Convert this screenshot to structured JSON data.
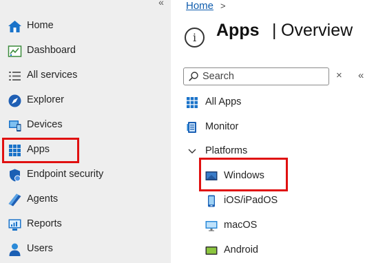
{
  "sidebar": {
    "collapse_glyph": "«",
    "items": [
      {
        "label": "Home",
        "icon": "home-icon"
      },
      {
        "label": "Dashboard",
        "icon": "dashboard-icon"
      },
      {
        "label": "All services",
        "icon": "list-icon"
      },
      {
        "label": "Explorer",
        "icon": "explorer-icon"
      },
      {
        "label": "Devices",
        "icon": "devices-icon"
      },
      {
        "label": "Apps",
        "icon": "apps-grid-icon"
      },
      {
        "label": "Endpoint security",
        "icon": "shield-icon"
      },
      {
        "label": "Agents",
        "icon": "agents-icon"
      },
      {
        "label": "Reports",
        "icon": "reports-icon"
      },
      {
        "label": "Users",
        "icon": "user-icon"
      }
    ],
    "highlighted": "Apps"
  },
  "main": {
    "breadcrumb": {
      "home": "Home",
      "separator": ">"
    },
    "title": {
      "bold": "Apps",
      "separator": "|",
      "sub": "Overview"
    },
    "search": {
      "placeholder": "Search",
      "value": ""
    },
    "clear_glyph": "×",
    "more_glyph": "«",
    "menu": {
      "all_apps": "All Apps",
      "monitor": "Monitor",
      "platforms": "Platforms",
      "windows": "Windows",
      "ios": "iOS/iPadOS",
      "macos": "macOS",
      "android": "Android"
    },
    "highlighted": "Windows"
  },
  "colors": {
    "highlight": "#e01010",
    "link": "#0f5cad",
    "nav_bg": "#eeeeee",
    "accent": "#0078d4"
  }
}
